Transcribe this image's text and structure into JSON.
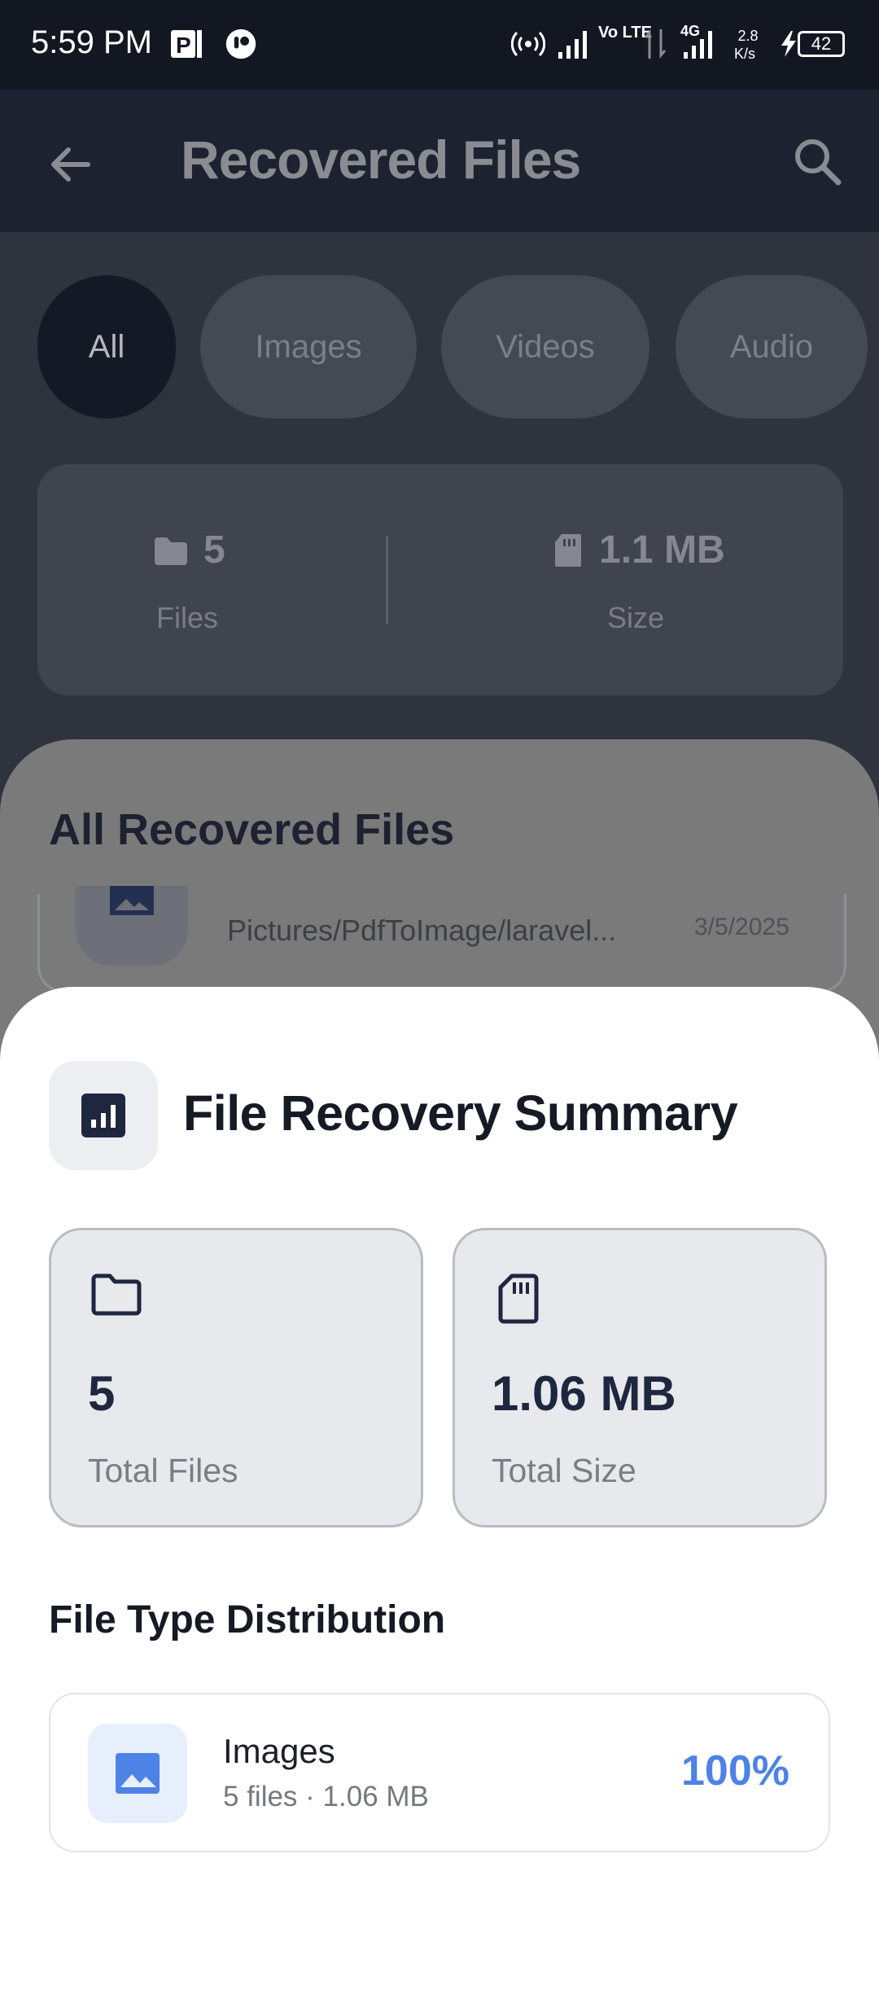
{
  "status_bar": {
    "time": "5:59 PM",
    "network_type": "4G",
    "volte": "Vo LTE",
    "speed_value": "2.8",
    "speed_unit": "K/s",
    "battery": "42"
  },
  "app_bar": {
    "title": "Recovered Files",
    "back_icon": "arrow-left-icon",
    "search_icon": "search-icon"
  },
  "filter_chips": [
    "All",
    "Images",
    "Videos",
    "Audio"
  ],
  "stats": {
    "files_value": "5",
    "files_label": "Files",
    "size_value": "1.1 MB",
    "size_label": "Size"
  },
  "list": {
    "heading": "All Recovered Files",
    "item": {
      "path": "Pictures/PdfToImage/laravel...",
      "date": "3/5/2025"
    }
  },
  "summary": {
    "title": "File Recovery Summary",
    "header_icon": "bar-chart-icon",
    "total_files_value": "5",
    "total_files_label": "Total Files",
    "total_size_value": "1.06 MB",
    "total_size_label": "Total Size",
    "distribution_title": "File Type Distribution",
    "distribution": [
      {
        "type": "Images",
        "details": "5 files · 1.06 MB",
        "percent": "100%",
        "icon": "image-icon"
      }
    ]
  },
  "colors": {
    "accent": "#4d82e6",
    "navy": "#1f2740",
    "sheet": "#ffffff",
    "card_bg": "#e8e9ec"
  }
}
